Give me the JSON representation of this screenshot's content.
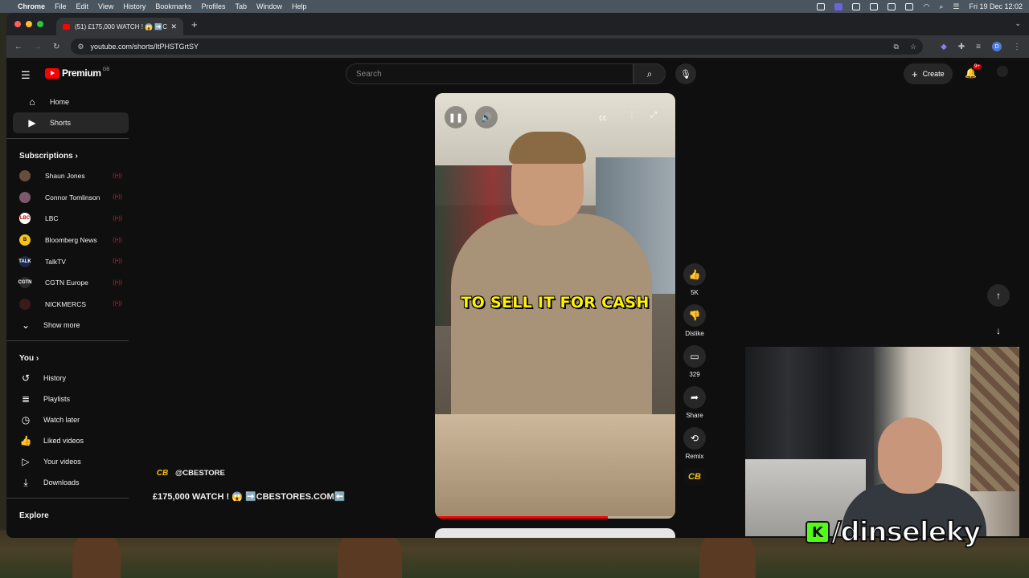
{
  "menubar": {
    "app": "Chrome",
    "items": [
      "File",
      "Edit",
      "View",
      "History",
      "Bookmarks",
      "Profiles",
      "Tab",
      "Window",
      "Help"
    ],
    "clock": "Fri 19 Dec  12:02"
  },
  "browser": {
    "tab_title": "(51) £175,000 WATCH ! 😱 ➡️CBESTO",
    "url": "youtube.com/shorts/ItPHSTGrtSY",
    "profile_initial": "D"
  },
  "youtube": {
    "logo_text": "Premium",
    "logo_region": "GB",
    "search_placeholder": "Search",
    "create_label": "Create",
    "notif_badge": "9+",
    "nav": [
      {
        "label": "Home",
        "icon": "home-icon"
      },
      {
        "label": "Shorts",
        "icon": "shorts-icon"
      }
    ],
    "subscriptions_title": "Subscriptions",
    "subscriptions": [
      {
        "name": "Shaun Jones",
        "color": "#6a4c3c",
        "initial": ""
      },
      {
        "name": "Connor Tomlinson",
        "color": "#7a5a6a",
        "initial": ""
      },
      {
        "name": "LBC",
        "color": "#ffffff",
        "initial": "LBC"
      },
      {
        "name": "Bloomberg News",
        "color": "#f4c21a",
        "initial": "B"
      },
      {
        "name": "TalkTV",
        "color": "#1c2a4a",
        "initial": "TALK"
      },
      {
        "name": "CGTN Europe",
        "color": "#2a2a2a",
        "initial": "CGTN"
      },
      {
        "name": "NICKMERCS",
        "color": "#3a1a1a",
        "initial": ""
      }
    ],
    "show_more": "Show more",
    "you_title": "You",
    "you_items": [
      {
        "label": "History",
        "icon": "history-icon"
      },
      {
        "label": "Playlists",
        "icon": "playlists-icon"
      },
      {
        "label": "Watch later",
        "icon": "watch-later-icon"
      },
      {
        "label": "Liked videos",
        "icon": "liked-videos-icon"
      },
      {
        "label": "Your videos",
        "icon": "your-videos-icon"
      },
      {
        "label": "Downloads",
        "icon": "downloads-icon"
      }
    ],
    "explore_title": "Explore"
  },
  "short": {
    "caption": "TO SELL IT FOR CASH",
    "progress": 0.72,
    "channel_handle": "@CBESTORE",
    "title": "£175,000 WATCH ! 😱 ➡️CBESTORES.COM⬅️",
    "likes": "5K",
    "dislike_label": "Dislike",
    "comments": "329",
    "share_label": "Share",
    "remix_label": "Remix",
    "channel_logo": "CB"
  },
  "overlay": {
    "handle": "/dinseleky",
    "kick_letter": "K"
  }
}
